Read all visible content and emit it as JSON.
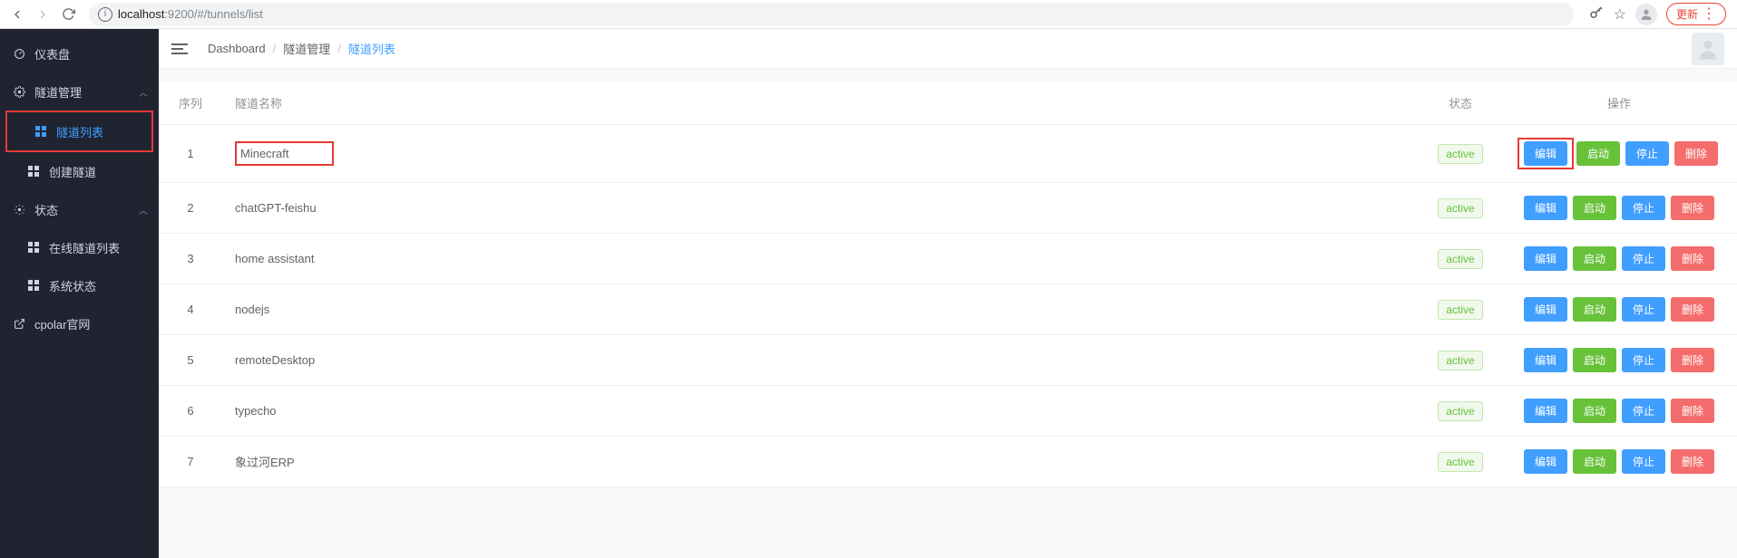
{
  "browser": {
    "url_host": "localhost",
    "url_port": ":9200",
    "url_path": "/#/tunnels/list",
    "update_label": "更新"
  },
  "sidebar": {
    "items": [
      {
        "icon": "dashboard",
        "label": "仪表盘"
      },
      {
        "icon": "gear",
        "label": "隧道管理",
        "expanded": true
      },
      {
        "icon": "grid",
        "label": "隧道列表",
        "sub": true,
        "active": true
      },
      {
        "icon": "grid",
        "label": "创建隧道",
        "sub": true
      },
      {
        "icon": "gear",
        "label": "状态",
        "expanded": true
      },
      {
        "icon": "grid",
        "label": "在线隧道列表",
        "sub": true
      },
      {
        "icon": "grid",
        "label": "系统状态",
        "sub": true
      },
      {
        "icon": "external",
        "label": "cpolar官网"
      }
    ]
  },
  "breadcrumb": {
    "root": "Dashboard",
    "mid": "隧道管理",
    "leaf": "隧道列表"
  },
  "table": {
    "headers": {
      "idx": "序列",
      "name": "隧道名称",
      "status": "状态",
      "ops": "操作"
    },
    "ops_labels": {
      "edit": "编辑",
      "start": "启动",
      "stop": "停止",
      "delete": "删除"
    },
    "rows": [
      {
        "idx": "1",
        "name": "Minecraft",
        "status": "active"
      },
      {
        "idx": "2",
        "name": "chatGPT-feishu",
        "status": "active"
      },
      {
        "idx": "3",
        "name": "home assistant",
        "status": "active"
      },
      {
        "idx": "4",
        "name": "nodejs",
        "status": "active"
      },
      {
        "idx": "5",
        "name": "remoteDesktop",
        "status": "active"
      },
      {
        "idx": "6",
        "name": "typecho",
        "status": "active"
      },
      {
        "idx": "7",
        "name": "象过河ERP",
        "status": "active"
      }
    ]
  }
}
